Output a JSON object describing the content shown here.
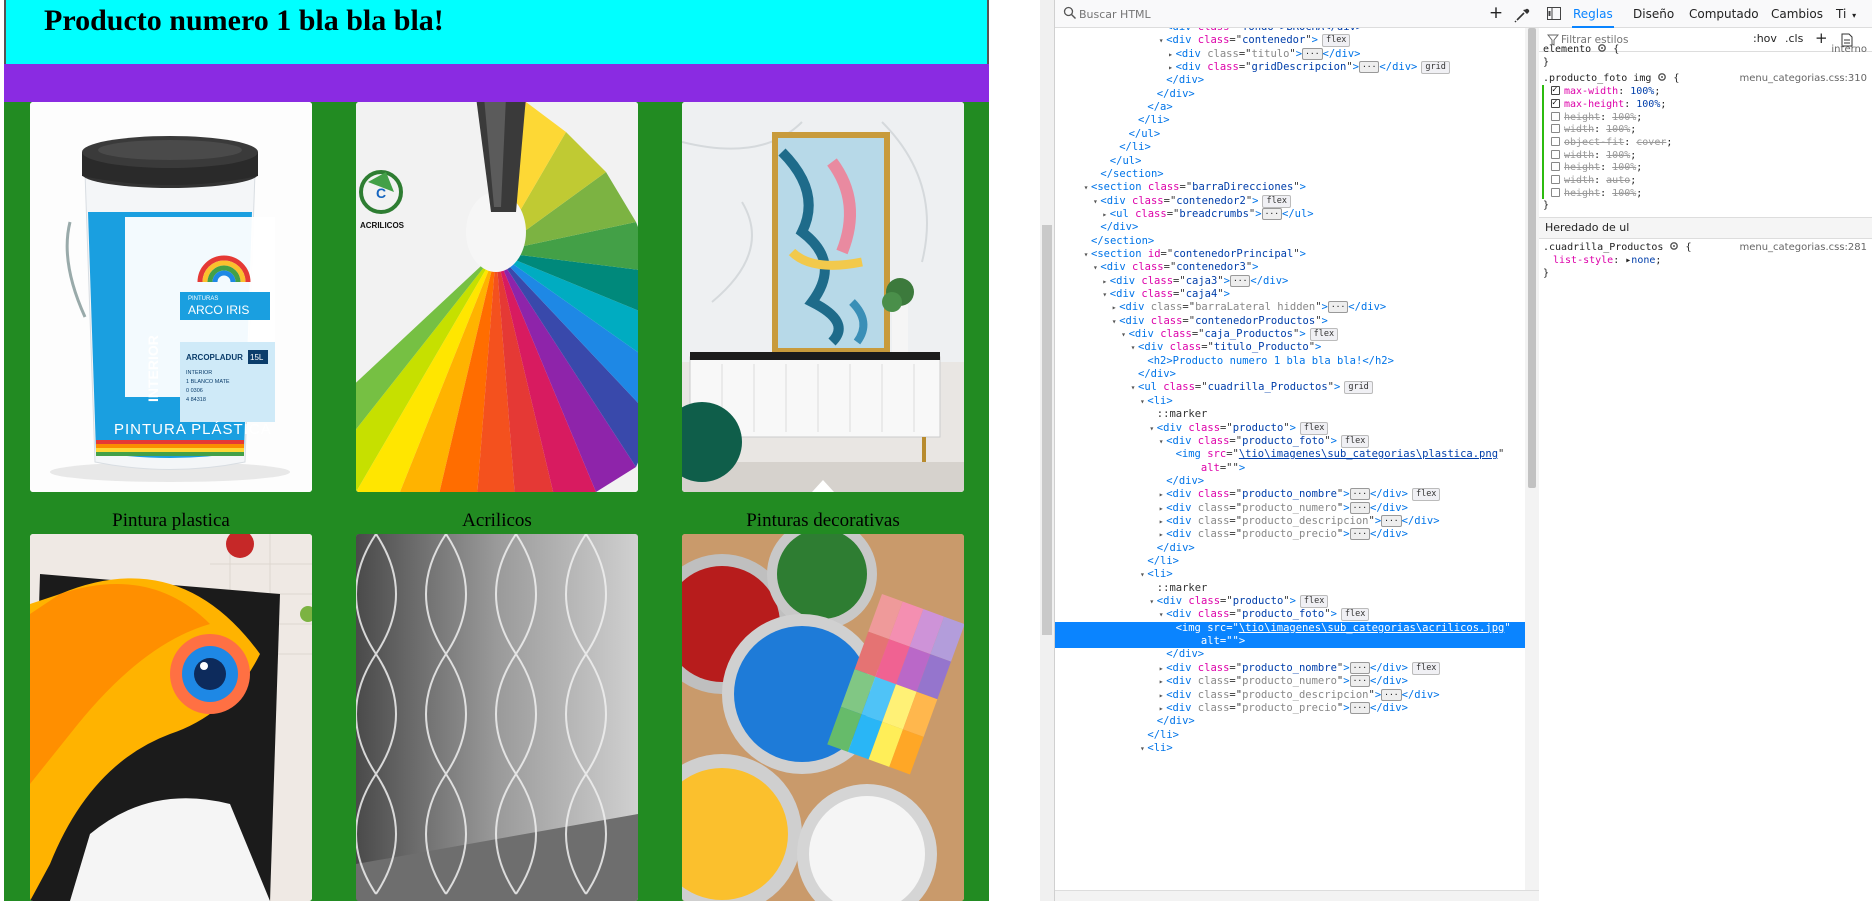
{
  "viewport": {
    "page_title": "Producto numero 1 bla bla bla!",
    "captions": [
      "Pintura plastica",
      "Acrilicos",
      "Pinturas decorativas"
    ],
    "paint_bucket": {
      "brand": "ARCO IRIS",
      "brand_small": "PINTURAS",
      "product": "ARCOPLADUR",
      "product_lines": [
        "INTERIOR",
        "1 BLANCO MATE",
        "0 0306",
        "4 84318"
      ],
      "side_label": "INTERIOR",
      "bottom_label": "PINTURA PLÁSTICA",
      "volume": "15L"
    },
    "acrilicos_logo": "ACRILICOS"
  },
  "inspector": {
    "search_placeholder": "Buscar HTML",
    "add_label": "+",
    "tree": [
      {
        "d": 8,
        "tw": "",
        "open": "<div",
        "attrs": [
          [
            "class",
            "fondo\">BROCHA</div>"
          ]
        ],
        "close": "",
        "badge": "",
        "cut": true
      },
      {
        "d": 8,
        "tw": "▾",
        "open": "<div",
        "attrs": [
          [
            "class",
            "contenedor"
          ]
        ],
        "close": ">",
        "badge": "flex"
      },
      {
        "d": 9,
        "tw": "▸",
        "open": "<div",
        "attrs": [
          [
            "class",
            "titulo"
          ]
        ],
        "close": ">",
        "ellipsis": true,
        "end": "</div>",
        "dim": true
      },
      {
        "d": 9,
        "tw": "▸",
        "open": "<div",
        "attrs": [
          [
            "class",
            "gridDescripcion"
          ]
        ],
        "close": ">",
        "ellipsis": true,
        "end": "</div>",
        "badge": "grid"
      },
      {
        "d": 8,
        "tw": "",
        "raw": "</div>"
      },
      {
        "d": 7,
        "tw": "",
        "raw": "</div>"
      },
      {
        "d": 6,
        "tw": "",
        "raw": "</a>"
      },
      {
        "d": 5,
        "tw": "",
        "raw": "</li>"
      },
      {
        "d": 4,
        "tw": "",
        "raw": "</ul>"
      },
      {
        "d": 3,
        "tw": "",
        "raw": "</li>"
      },
      {
        "d": 2,
        "tw": "",
        "raw": "</ul>"
      },
      {
        "d": 1,
        "tw": "",
        "raw": "</section>"
      },
      {
        "d": 0,
        "tw": "▾",
        "open": "<section",
        "attrs": [
          [
            "class",
            "barraDirecciones"
          ]
        ],
        "close": ">"
      },
      {
        "d": 1,
        "tw": "▾",
        "open": "<div",
        "attrs": [
          [
            "class",
            "contenedor2"
          ]
        ],
        "close": ">",
        "badge": "flex"
      },
      {
        "d": 2,
        "tw": "▸",
        "open": "<ul",
        "attrs": [
          [
            "class",
            "breadcrumbs"
          ]
        ],
        "close": ">",
        "ellipsis": true,
        "end": "</ul>"
      },
      {
        "d": 1,
        "tw": "",
        "raw": "</div>"
      },
      {
        "d": 0,
        "tw": "",
        "raw": "</section>"
      },
      {
        "d": 0,
        "tw": "▾",
        "open": "<section",
        "attrs": [
          [
            "id",
            "contenedorPrincipal"
          ]
        ],
        "close": ">"
      },
      {
        "d": 1,
        "tw": "▾",
        "open": "<div",
        "attrs": [
          [
            "class",
            "contenedor3"
          ]
        ],
        "close": ">"
      },
      {
        "d": 2,
        "tw": "▸",
        "open": "<div",
        "attrs": [
          [
            "class",
            "caja3"
          ]
        ],
        "close": ">",
        "ellipsis": true,
        "end": "</div>"
      },
      {
        "d": 2,
        "tw": "▾",
        "open": "<div",
        "attrs": [
          [
            "class",
            "caja4"
          ]
        ],
        "close": ">"
      },
      {
        "d": 3,
        "tw": "▸",
        "open": "<div",
        "attrs": [
          [
            "class",
            "barraLateral hidden"
          ]
        ],
        "close": ">",
        "ellipsis": true,
        "end": "</div>",
        "dim": true
      },
      {
        "d": 3,
        "tw": "▾",
        "open": "<div",
        "attrs": [
          [
            "class",
            "contenedorProductos"
          ]
        ],
        "close": ">"
      },
      {
        "d": 4,
        "tw": "▾",
        "open": "<div",
        "attrs": [
          [
            "class",
            "caja_Productos"
          ]
        ],
        "close": ">",
        "badge": "flex"
      },
      {
        "d": 5,
        "tw": "▾",
        "open": "<div",
        "attrs": [
          [
            "class",
            "titulo_Producto"
          ]
        ],
        "close": ">"
      },
      {
        "d": 6,
        "tw": "",
        "raw": "<h2>Producto numero 1 bla bla bla!</h2>"
      },
      {
        "d": 5,
        "tw": "",
        "raw": "</div>"
      },
      {
        "d": 5,
        "tw": "▾",
        "open": "<ul",
        "attrs": [
          [
            "class",
            "cuadrilla_Productos"
          ]
        ],
        "close": ">",
        "badge": "grid"
      },
      {
        "d": 6,
        "tw": "▾",
        "raw": "<li>"
      },
      {
        "d": 7,
        "tw": "",
        "raw": "::marker",
        "pseudo": true
      },
      {
        "d": 7,
        "tw": "▾",
        "open": "<div",
        "attrs": [
          [
            "class",
            "producto"
          ]
        ],
        "close": ">",
        "badge": "flex"
      },
      {
        "d": 8,
        "tw": "▾",
        "open": "<div",
        "attrs": [
          [
            "class",
            "producto_foto"
          ]
        ],
        "close": ">",
        "badge": "flex"
      },
      {
        "d": 9,
        "tw": "",
        "open": "<img",
        "attrs": [
          [
            "src",
            "\\tio\\imagenes\\sub_categorias\\plastica.png"
          ]
        ],
        "close": "",
        "link": true
      },
      {
        "d": 9,
        "tw": "",
        "cont": true,
        "attrs": [
          [
            "alt",
            ""
          ]
        ],
        "close": ">"
      },
      {
        "d": 8,
        "tw": "",
        "raw": "</div>"
      },
      {
        "d": 8,
        "tw": "▸",
        "open": "<div",
        "attrs": [
          [
            "class",
            "producto_nombre"
          ]
        ],
        "close": ">",
        "ellipsis": true,
        "end": "</div>",
        "badge": "flex"
      },
      {
        "d": 8,
        "tw": "▸",
        "open": "<div",
        "attrs": [
          [
            "class",
            "producto_numero"
          ]
        ],
        "close": ">",
        "ellipsis": true,
        "end": "</div>",
        "dim": true
      },
      {
        "d": 8,
        "tw": "▸",
        "open": "<div",
        "attrs": [
          [
            "class",
            "producto_descripcion"
          ]
        ],
        "close": ">",
        "ellipsis": true,
        "end": "</div>",
        "dim": true
      },
      {
        "d": 8,
        "tw": "▸",
        "open": "<div",
        "attrs": [
          [
            "class",
            "producto_precio"
          ]
        ],
        "close": ">",
        "ellipsis": true,
        "end": "</div>",
        "dim": true
      },
      {
        "d": 7,
        "tw": "",
        "raw": "</div>"
      },
      {
        "d": 6,
        "tw": "",
        "raw": "</li>"
      },
      {
        "d": 6,
        "tw": "▾",
        "raw": "<li>"
      },
      {
        "d": 7,
        "tw": "",
        "raw": "::marker",
        "pseudo": true
      },
      {
        "d": 7,
        "tw": "▾",
        "open": "<div",
        "attrs": [
          [
            "class",
            "producto"
          ]
        ],
        "close": ">",
        "badge": "flex"
      },
      {
        "d": 8,
        "tw": "▾",
        "open": "<div",
        "attrs": [
          [
            "class",
            "producto_foto"
          ]
        ],
        "close": ">",
        "badge": "flex"
      },
      {
        "d": 9,
        "tw": "",
        "open": "<img",
        "attrs": [
          [
            "src",
            "\\tio\\imagenes\\sub_categorias\\acrilicos.jpg"
          ]
        ],
        "close": "",
        "link": true,
        "selected": true
      },
      {
        "d": 9,
        "tw": "",
        "cont": true,
        "attrs": [
          [
            "alt",
            ""
          ]
        ],
        "close": ">",
        "selected": true
      },
      {
        "d": 8,
        "tw": "",
        "raw": "</div>"
      },
      {
        "d": 8,
        "tw": "▸",
        "open": "<div",
        "attrs": [
          [
            "class",
            "producto_nombre"
          ]
        ],
        "close": ">",
        "ellipsis": true,
        "end": "</div>",
        "badge": "flex"
      },
      {
        "d": 8,
        "tw": "▸",
        "open": "<div",
        "attrs": [
          [
            "class",
            "producto_numero"
          ]
        ],
        "close": ">",
        "ellipsis": true,
        "end": "</div>",
        "dim": true
      },
      {
        "d": 8,
        "tw": "▸",
        "open": "<div",
        "attrs": [
          [
            "class",
            "producto_descripcion"
          ]
        ],
        "close": ">",
        "ellipsis": true,
        "end": "</div>",
        "dim": true
      },
      {
        "d": 8,
        "tw": "▸",
        "open": "<div",
        "attrs": [
          [
            "class",
            "producto_precio"
          ]
        ],
        "close": ">",
        "ellipsis": true,
        "end": "</div>",
        "dim": true
      },
      {
        "d": 7,
        "tw": "",
        "raw": "</div>"
      },
      {
        "d": 6,
        "tw": "",
        "raw": "</li>"
      },
      {
        "d": 6,
        "tw": "▾",
        "raw": "<li>"
      }
    ]
  },
  "sidebar": {
    "tabs": [
      "Reglas",
      "Diseño",
      "Computado",
      "Cambios",
      "Ti"
    ],
    "active_tab": "Reglas",
    "filter_placeholder": "Filtrar estilos",
    "hov_label": ":hov",
    "cls_label": ".cls",
    "add_label": "+",
    "element_rule": {
      "selector": "elemento",
      "brace": "{",
      "source": "interno"
    },
    "rules": [
      {
        "selector": ".producto_foto img",
        "source": "menu_categorias.css:310",
        "props": [
          {
            "name": "max-width",
            "value": "100%",
            "on": true,
            "struck": false
          },
          {
            "name": "max-height",
            "value": "100%",
            "on": true,
            "struck": false
          },
          {
            "name": "height",
            "value": "100%",
            "on": false,
            "struck": true
          },
          {
            "name": "width",
            "value": "100%",
            "on": false,
            "struck": true
          },
          {
            "name": "object-fit",
            "value": "cover",
            "on": false,
            "struck": true
          },
          {
            "name": "width",
            "value": "100%",
            "on": false,
            "struck": true
          },
          {
            "name": "height",
            "value": "100%",
            "on": false,
            "struck": true
          },
          {
            "name": "width",
            "value": "auto",
            "on": false,
            "struck": true
          },
          {
            "name": "height",
            "value": "100%",
            "on": false,
            "struck": true
          }
        ]
      }
    ],
    "inherited_header": "Heredado de ul",
    "inherited_rule": {
      "selector": ".cuadrilla_Productos",
      "source": "menu_categorias.css:281",
      "prop": "list-style",
      "value": "none"
    },
    "colors": {
      "accent": "#0a84ff",
      "selected_row": "#0a84ff",
      "prop_name": "#dd00a9",
      "attr_value": "#003eaa"
    }
  }
}
